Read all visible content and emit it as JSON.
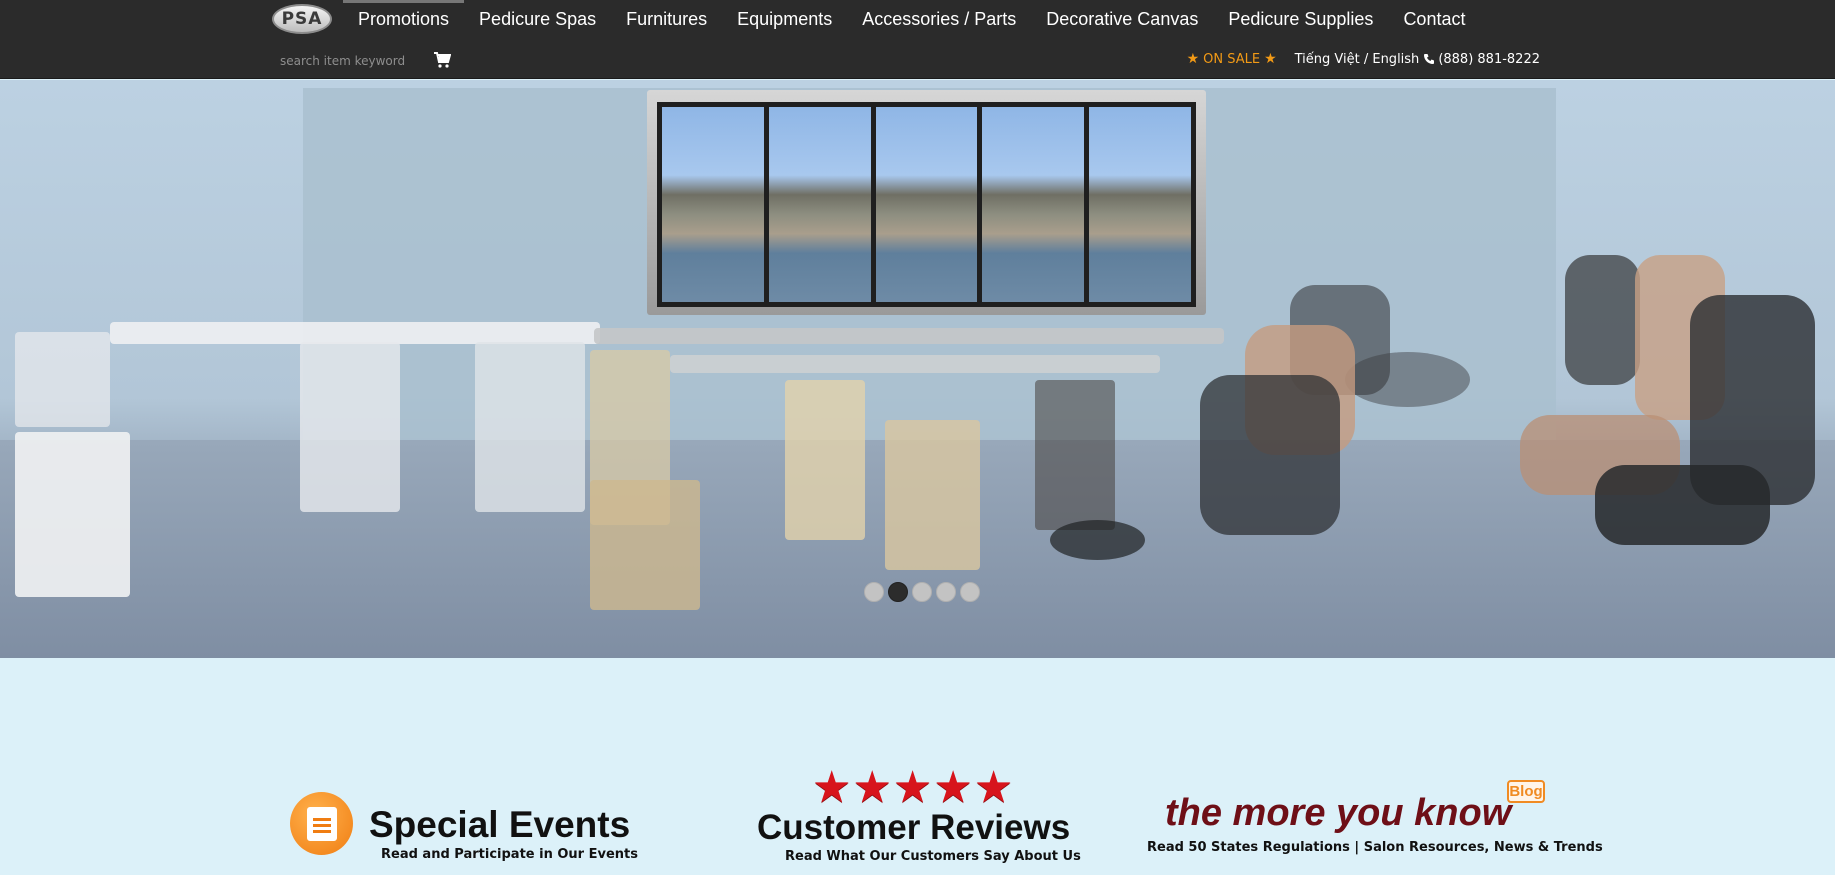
{
  "nav": {
    "logo_text": "PSA",
    "items": [
      {
        "label": "Promotions"
      },
      {
        "label": "Pedicure Spas"
      },
      {
        "label": "Furnitures"
      },
      {
        "label": "Equipments"
      },
      {
        "label": "Accessories / Parts"
      },
      {
        "label": "Decorative Canvas"
      },
      {
        "label": "Pedicure Supplies"
      },
      {
        "label": "Contact"
      }
    ]
  },
  "search": {
    "placeholder": "search item keyword",
    "value": ""
  },
  "header_links": {
    "on_sale": "ON SALE",
    "language": "Tiếng Việt / English",
    "phone": "(888) 881-8222"
  },
  "slider": {
    "total_slides": 5,
    "active_slide": 2
  },
  "features": {
    "events": {
      "title": "Special Events",
      "subtitle": "Read and Participate in Our Events"
    },
    "reviews": {
      "title": "Customer Reviews",
      "subtitle": "Read What Our Customers Say About Us",
      "star_count": 5
    },
    "blog": {
      "title": "the more you know",
      "badge": "Blog",
      "subtitle": "Read 50 States Regulations | Salon Resources, News & Trends"
    }
  },
  "colors": {
    "nav_bg": "#2b2b2b",
    "sale_orange": "#f29a16",
    "page_bg": "#dcf1f9",
    "star_red": "#d7141c",
    "blog_maroon": "#6e0f17"
  }
}
